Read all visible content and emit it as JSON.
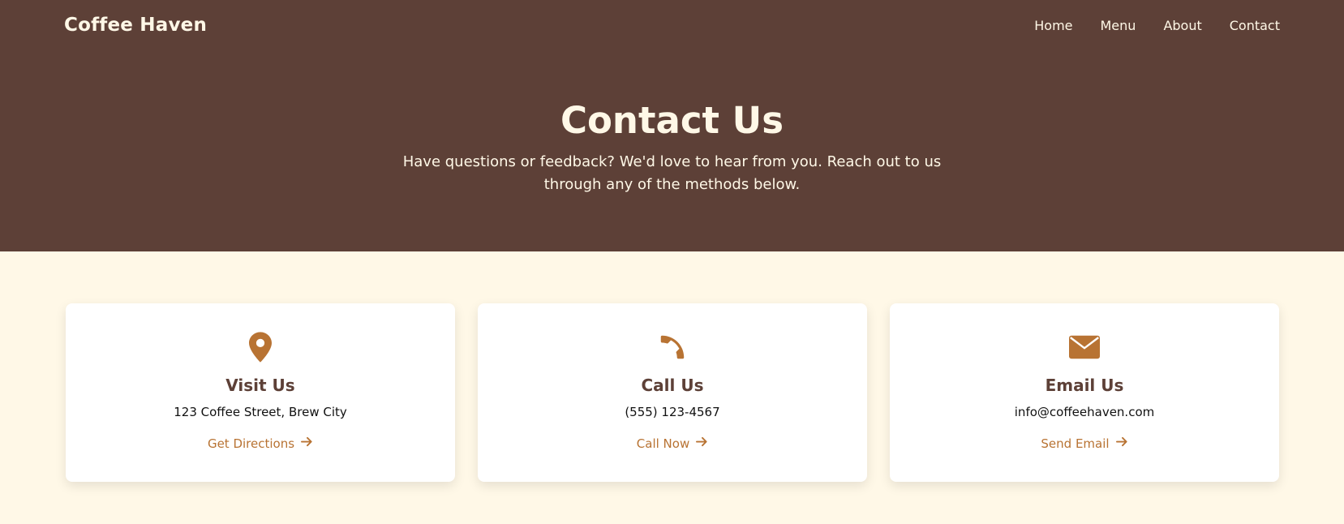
{
  "brand": "Coffee Haven",
  "nav": [
    "Home",
    "Menu",
    "About",
    "Contact"
  ],
  "hero": {
    "title": "Contact Us",
    "subtitle": "Have questions or feedback? We'd love to hear from you. Reach out to us through any of the methods below."
  },
  "cards": [
    {
      "icon": "map-pin-icon",
      "title": "Visit Us",
      "info": "123 Coffee Street, Brew City",
      "link": "Get Directions"
    },
    {
      "icon": "phone-icon",
      "title": "Call Us",
      "info": "(555) 123-4567",
      "link": "Call Now"
    },
    {
      "icon": "envelope-icon",
      "title": "Email Us",
      "info": "info@coffeehaven.com",
      "link": "Send Email"
    }
  ],
  "colors": {
    "hero_bg": "#5D4037",
    "page_bg": "#FFF8E7",
    "accent": "#B87333",
    "heading": "#5D4037"
  }
}
